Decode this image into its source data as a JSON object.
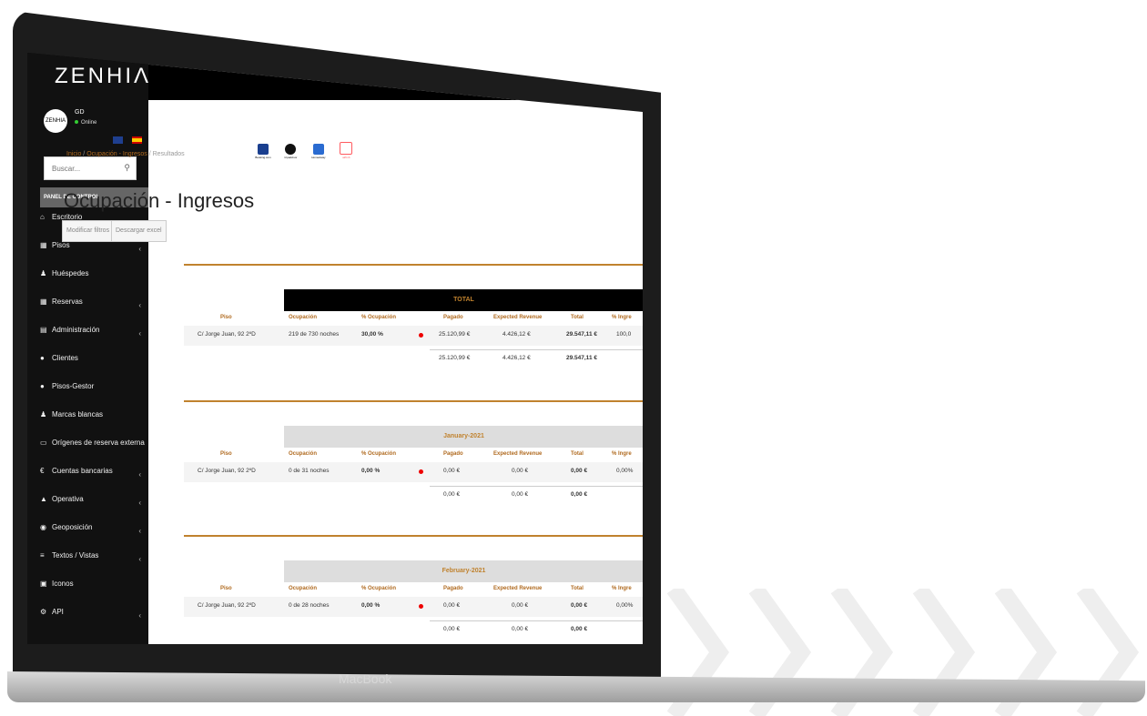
{
  "device": {
    "brand": "MacBook"
  },
  "app": {
    "logo": "ZENHIΛ",
    "menu_toggle": "≡"
  },
  "user": {
    "avatar_text": "ZENHIA",
    "name": "GD",
    "status": "Online"
  },
  "search": {
    "placeholder": "Buscar..."
  },
  "panel_header": "PANEL DE CONTROL",
  "nav": [
    {
      "label": "Escritorio",
      "icon": "home-icon",
      "expand": false
    },
    {
      "label": "Pisos",
      "icon": "building-icon",
      "expand": true
    },
    {
      "label": "Huéspedes",
      "icon": "user-icon",
      "expand": false
    },
    {
      "label": "Reservas",
      "icon": "calendar-icon",
      "expand": true
    },
    {
      "label": "Administración",
      "icon": "chart-icon",
      "expand": true
    },
    {
      "label": "Clientes",
      "icon": "clients-icon",
      "expand": false
    },
    {
      "label": "Pisos-Gestor",
      "icon": "manager-icon",
      "expand": false
    },
    {
      "label": "Marcas blancas",
      "icon": "tag-icon",
      "expand": false
    },
    {
      "label": "Orígenes de reserva externa",
      "icon": "laptop-icon",
      "expand": false
    },
    {
      "label": "Cuentas bancarias",
      "icon": "euro-icon",
      "expand": true
    },
    {
      "label": "Operativa",
      "icon": "shirt-icon",
      "expand": true
    },
    {
      "label": "Geoposición",
      "icon": "pin-icon",
      "expand": true
    },
    {
      "label": "Textos / Vistas",
      "icon": "text-icon",
      "expand": true
    },
    {
      "label": "Iconos",
      "icon": "image-icon",
      "expand": false
    },
    {
      "label": "API",
      "icon": "api-icon",
      "expand": true
    }
  ],
  "providers": [
    "Booking.com",
    "tripadvisor",
    "HomeAway",
    "airbnb"
  ],
  "breadcrumb": {
    "home": "Inicio",
    "section": "Ocupación - Ingresos",
    "current": "Resultados",
    "sep": "/"
  },
  "page_title": "Ocupación - Ingresos",
  "buttons": {
    "filters": "Modificar filtros",
    "excel": "Descargar excel"
  },
  "columns": {
    "piso": "Piso",
    "ocupacion": "Ocupación",
    "pct": "% Ocupación",
    "pagado": "Pagado",
    "expected": "Expected Revenue",
    "total": "Total",
    "pct_ingresos": "% Ingre"
  },
  "blocks": [
    {
      "period": "TOTAL",
      "style": "dark",
      "piso": "C/ Jorge Juan, 92 2ºD",
      "ocupacion": "219 de 730 noches",
      "pct": "30,00 %",
      "pagado": "25.120,99 €",
      "expected": "4.426,12 €",
      "total": "29.547,11 €",
      "pct_ingresos": "100,0",
      "sum_pagado": "25.120,99 €",
      "sum_expected": "4.426,12 €",
      "sum_total": "29.547,11 €"
    },
    {
      "period": "January-2021",
      "style": "light",
      "piso": "C/ Jorge Juan, 92 2ºD",
      "ocupacion": "0 de 31 noches",
      "pct": "0,00 %",
      "pagado": "0,00 €",
      "expected": "0,00 €",
      "total": "0,00 €",
      "pct_ingresos": "0,00%",
      "sum_pagado": "0,00 €",
      "sum_expected": "0,00 €",
      "sum_total": "0,00 €"
    },
    {
      "period": "February-2021",
      "style": "light",
      "piso": "C/ Jorge Juan, 92 2ºD",
      "ocupacion": "0 de 28 noches",
      "pct": "0,00 %",
      "pagado": "0,00 €",
      "expected": "0,00 €",
      "total": "0,00 €",
      "pct_ingresos": "0,00%",
      "sum_pagado": "0,00 €",
      "sum_expected": "0,00 €",
      "sum_total": "0,00 €"
    }
  ]
}
